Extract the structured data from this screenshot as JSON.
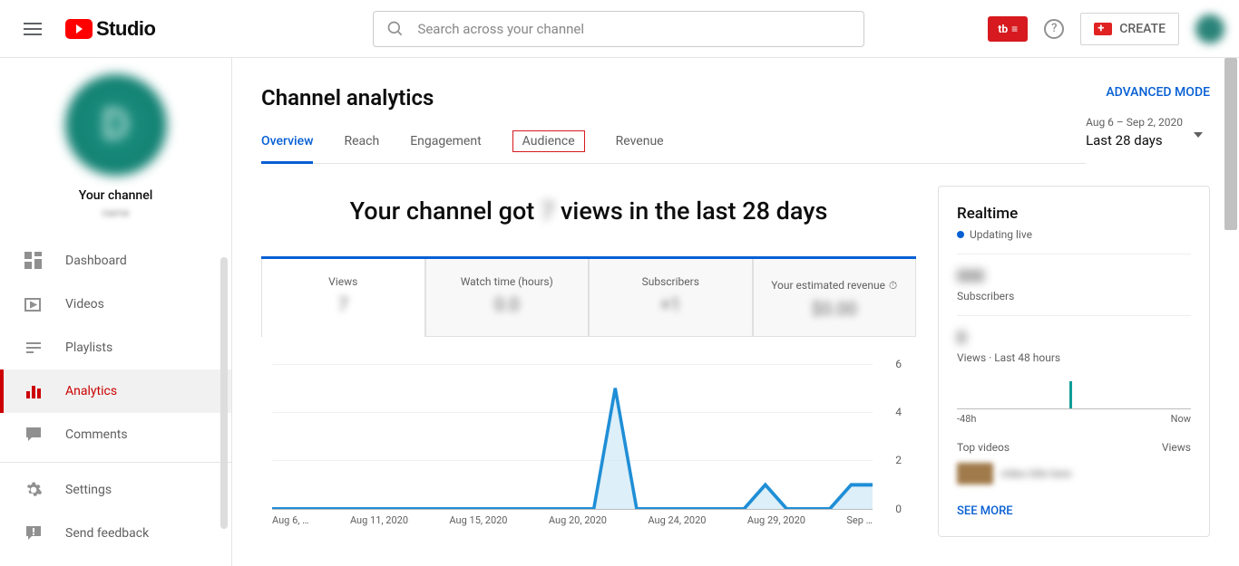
{
  "header": {
    "logo_text": "Studio",
    "search_placeholder": "Search across your channel",
    "create_label": "CREATE"
  },
  "sidebar": {
    "channel_label": "Your channel",
    "channel_letter": "D",
    "items": [
      {
        "label": "Dashboard"
      },
      {
        "label": "Videos"
      },
      {
        "label": "Playlists"
      },
      {
        "label": "Analytics"
      },
      {
        "label": "Comments"
      },
      {
        "label": "Settings"
      },
      {
        "label": "Send feedback"
      }
    ]
  },
  "page": {
    "title": "Channel analytics",
    "advanced_label": "ADVANCED MODE",
    "date_range_text": "Aug 6 – Sep 2, 2020",
    "date_range_label": "Last 28 days",
    "tabs": [
      "Overview",
      "Reach",
      "Engagement",
      "Audience",
      "Revenue"
    ]
  },
  "headline_pre": "Your channel got ",
  "headline_post": " views in the last 28 days",
  "metrics": [
    {
      "label": "Views",
      "value": "7"
    },
    {
      "label": "Watch time (hours)",
      "value": "0.0"
    },
    {
      "label": "Subscribers",
      "value": "+1"
    },
    {
      "label": "Your estimated revenue",
      "value": "$0.00"
    }
  ],
  "chart_data": {
    "type": "line",
    "title": "Views",
    "xlabel": "",
    "ylabel": "",
    "ylim": [
      0,
      6
    ],
    "categories": [
      "Aug 6, …",
      "Aug 11, 2020",
      "Aug 15, 2020",
      "Aug 20, 2020",
      "Aug 24, 2020",
      "Aug 29, 2020",
      "Sep …"
    ],
    "y_ticks": [
      "6",
      "4",
      "2",
      "0"
    ],
    "series": [
      {
        "name": "Views",
        "x": [
          0,
          1,
          2,
          3,
          4,
          5,
          6,
          7,
          8,
          9,
          10,
          11,
          12,
          13,
          14,
          15,
          16,
          17,
          18,
          19,
          20,
          21,
          22,
          23,
          24,
          25,
          26,
          27
        ],
        "values": [
          0,
          0,
          0,
          0,
          0,
          0,
          0,
          0,
          0,
          0,
          0,
          0,
          0,
          0,
          0,
          0,
          5,
          0,
          0,
          0,
          0,
          0,
          0,
          1,
          0,
          0,
          0,
          1
        ]
      }
    ]
  },
  "realtime": {
    "title": "Realtime",
    "updating_label": "Updating live",
    "subscribers_label": "Subscribers",
    "views_48_label": "Views · Last 48 hours",
    "spark_left": "-48h",
    "spark_right": "Now",
    "top_videos_label": "Top videos",
    "top_views_label": "Views",
    "see_more_label": "SEE MORE"
  }
}
